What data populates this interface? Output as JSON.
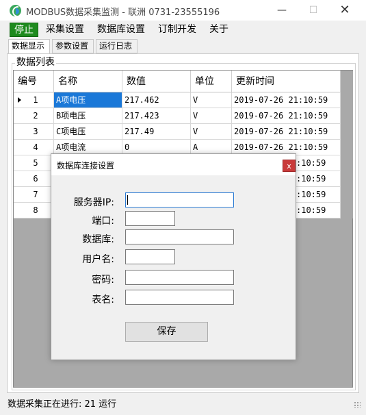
{
  "window": {
    "title": "MODBUS数据采集监测 - 联洲 0731-23555196",
    "min_glyph": "—",
    "max_glyph": "☐",
    "close_glyph": "✕"
  },
  "menu": {
    "stop": "停止",
    "items": [
      "采集设置",
      "数据库设置",
      "订制开发",
      "关于"
    ]
  },
  "tabs": [
    "数据显示",
    "参数设置",
    "运行日志"
  ],
  "group_label": "数据列表",
  "grid": {
    "columns": [
      "编号",
      "名称",
      "数值",
      "单位",
      "更新时间"
    ],
    "rows": [
      {
        "num": "1",
        "name": "A项电压",
        "value": "217.462",
        "unit": "V",
        "time": "2019-07-26 21:10:59"
      },
      {
        "num": "2",
        "name": "B项电压",
        "value": "217.423",
        "unit": "V",
        "time": "2019-07-26 21:10:59"
      },
      {
        "num": "3",
        "name": "C项电压",
        "value": "217.49",
        "unit": "V",
        "time": "2019-07-26 21:10:59"
      },
      {
        "num": "4",
        "name": "A项电流",
        "value": "0",
        "unit": "A",
        "time": "2019-07-26 21:10:59"
      },
      {
        "num": "5",
        "name": "",
        "value": "",
        "unit": "",
        "time": ":10:59"
      },
      {
        "num": "6",
        "name": "",
        "value": "",
        "unit": "",
        "time": ":10:59"
      },
      {
        "num": "7",
        "name": "",
        "value": "",
        "unit": "",
        "time": ":10:59"
      },
      {
        "num": "8",
        "name": "",
        "value": "",
        "unit": "",
        "time": ":10:59"
      }
    ]
  },
  "status": {
    "text": "数据采集正在进行: 21 运行"
  },
  "dialog": {
    "title": "数据库连接设置",
    "close_glyph": "x",
    "fields": {
      "server_ip": {
        "label": "服务器IP:",
        "value": ""
      },
      "port": {
        "label": "端口:",
        "value": ""
      },
      "database": {
        "label": "数据库:",
        "value": ""
      },
      "username": {
        "label": "用户名:",
        "value": ""
      },
      "password": {
        "label": "密码:",
        "value": ""
      },
      "table": {
        "label": "表名:",
        "value": ""
      }
    },
    "save": "保存"
  },
  "colors": {
    "stop_bg": "#1e8a1e",
    "selection": "#1a78d8",
    "dialog_close": "#c93a3a"
  }
}
